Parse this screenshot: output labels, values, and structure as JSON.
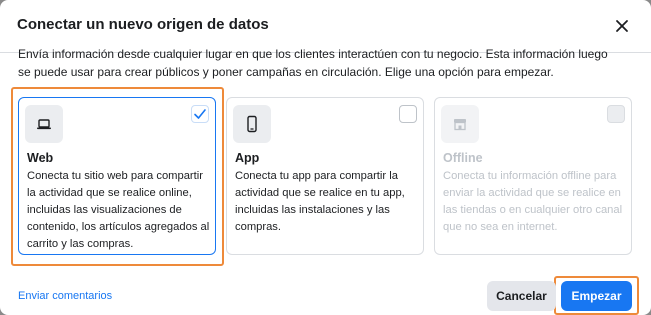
{
  "dialog": {
    "title": "Conectar un nuevo origen de datos",
    "description": "Envía información desde cualquier lugar en que los clientes interactúen con tu negocio. Esta información luego se puede usar para crear públicos y poner campañas en circulación. Elige una opción para empezar."
  },
  "options": [
    {
      "name": "Web",
      "icon": "laptop-icon",
      "selected": true,
      "disabled": false,
      "text": "Conecta tu sitio web para compartir la actividad que se realice online, incluidas las visualizaciones de contenido, los artículos agregados al carrito y las compras."
    },
    {
      "name": "App",
      "icon": "mobile-phone-icon",
      "selected": false,
      "disabled": false,
      "text": "Conecta tu app para compartir la actividad que se realice en tu app, incluidas las instalaciones y las compras."
    },
    {
      "name": "Offline",
      "icon": "store-icon",
      "selected": false,
      "disabled": true,
      "text": "Conecta tu información offline para enviar la actividad que se realice en las tiendas o en cualquier otro canal que no sea en internet."
    }
  ],
  "footer": {
    "feedback_link": "Enviar comentarios",
    "cancel_label": "Cancelar",
    "start_label": "Empezar"
  },
  "colors": {
    "accent": "#1877f2",
    "highlight": "#ee8a3a",
    "disabled_text": "#bec3c9"
  }
}
